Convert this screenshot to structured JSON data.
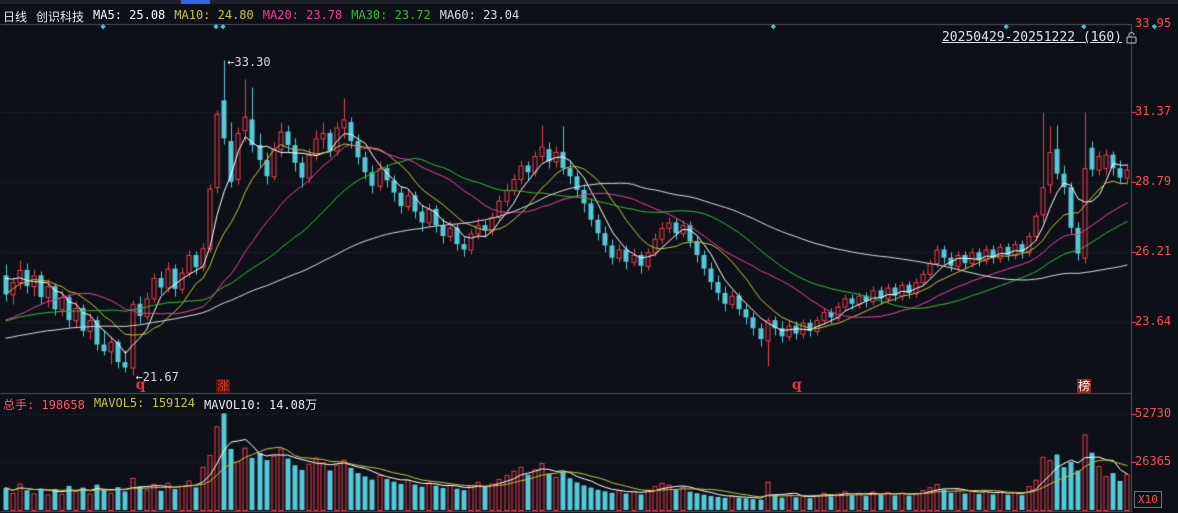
{
  "palette": {
    "background": "#0d1117",
    "up_red": "#f23a4c",
    "down_cyan": "#56c8d8",
    "axis_label_red": "#fb4d52",
    "grid_dotted": "#2b313b",
    "pane_border": "#4b5260",
    "ma5": "#ffffff",
    "ma10": "#c3c34a",
    "ma20": "#ec3f9e",
    "ma30": "#3cb53c",
    "ma60": "#d8dce4",
    "mavol5": "#ffffff",
    "mavol10": "#c3c34a",
    "header_text": "#e6e9ef",
    "annotation_text": "#d4d8de",
    "diamond_cyan": "#46c0cc",
    "scroll_thumb_blue": "#2e68e8",
    "badge_zhang_bg": "#5f1212",
    "badge_zhang_text": "#d93a3a",
    "badge_bang_bg": "#8d2727",
    "badge_bang_text": "#ffffff"
  },
  "header": {
    "period": "日线",
    "stock_name": "创识科技",
    "ma_items": [
      {
        "label": "MA5:",
        "value": "25.08",
        "color": "#ffffff"
      },
      {
        "label": "MA10:",
        "value": "24.80",
        "color": "#c3c34a"
      },
      {
        "label": "MA20:",
        "value": "23.78",
        "color": "#ec3f9e"
      },
      {
        "label": "MA30:",
        "value": "23.72",
        "color": "#3cb53c"
      },
      {
        "label": "MA60:",
        "value": "23.04",
        "color": "#d8dce4"
      }
    ]
  },
  "top_right": {
    "date_range": "20250429-20251222 (160)",
    "lock_icon": "lock"
  },
  "volume_header": {
    "items": [
      {
        "label": "总手:",
        "value": "198658",
        "color": "#ff5566"
      },
      {
        "label": "MAVOL5:",
        "value": "159124",
        "color": "#c3c34a"
      },
      {
        "label": "MAVOL10:",
        "value": "14.08万",
        "color": "#e8ecf2"
      }
    ]
  },
  "chart_data": {
    "type": "candlestick_with_volume",
    "title": "创识科技 日线",
    "date_range": "20250429-20251222",
    "bar_count": 160,
    "price_axis_labels": [
      "33.95",
      "31.37",
      "28.79",
      "26.21",
      "23.64"
    ],
    "price_axis_values": [
      33.95,
      31.37,
      28.79,
      26.21,
      23.64
    ],
    "volume_axis_labels": [
      "52730",
      "26365"
    ],
    "volume_axis_values": [
      52730,
      26365
    ],
    "volume_multiplier": "X10",
    "grid": "dotted-horizontal",
    "legend_position": "top-left",
    "annotations": {
      "high": {
        "text": "←33.30",
        "price": 33.3,
        "bar": 31
      },
      "low": {
        "text": "←21.67",
        "price": 21.67,
        "bar": 18
      }
    },
    "markers": [
      {
        "label": "q",
        "bar": 19,
        "style": "text"
      },
      {
        "label": "涨",
        "bar": 31,
        "style": "badge-dark"
      },
      {
        "label": "q",
        "bar": 112,
        "style": "text"
      },
      {
        "label": "榜",
        "bar": 153,
        "style": "badge-bright"
      }
    ],
    "event_diamond_bars": [
      14,
      30,
      31,
      109,
      142,
      153,
      163
    ],
    "ma_windows": [
      5,
      10,
      20,
      30,
      60
    ],
    "mavol_windows": [
      5,
      10
    ],
    "ma_seed_closes": [
      22.4,
      22.1,
      22.6,
      22.3,
      21.9,
      22.5,
      22.8,
      22.2,
      21.8,
      22.4,
      22.7,
      22.3,
      22.0,
      22.6,
      22.9,
      22.4,
      22.1,
      22.5,
      22.2,
      21.9,
      22.3,
      22.6,
      22.8,
      22.4,
      22.2,
      22.7,
      22.5,
      22.3,
      22.6,
      22.8,
      23.0,
      23.3,
      23.6,
      23.8,
      23.5,
      23.7,
      23.9,
      23.6,
      23.8,
      23.8,
      23.4,
      23.1,
      22.8,
      22.5,
      22.3,
      22.6,
      22.9,
      22.7,
      22.5,
      22.8,
      23.2,
      23.6,
      24.1,
      24.5,
      24.9,
      25.2,
      25.3,
      25.4,
      25.6
    ],
    "ohlc": [
      [
        25.35,
        25.75,
        24.4,
        24.65
      ],
      [
        24.65,
        25.3,
        24.3,
        25.1
      ],
      [
        25.1,
        25.9,
        24.85,
        25.55
      ],
      [
        25.55,
        25.8,
        24.7,
        24.95
      ],
      [
        24.95,
        25.6,
        24.6,
        25.35
      ],
      [
        25.35,
        25.5,
        24.3,
        24.55
      ],
      [
        24.55,
        25.2,
        24.2,
        24.95
      ],
      [
        24.95,
        25.05,
        23.9,
        24.1
      ],
      [
        24.1,
        24.8,
        23.85,
        24.55
      ],
      [
        24.55,
        24.65,
        23.45,
        23.7
      ],
      [
        23.7,
        24.4,
        23.4,
        24.15
      ],
      [
        24.15,
        24.3,
        23.1,
        23.3
      ],
      [
        23.3,
        23.95,
        23.0,
        23.7
      ],
      [
        23.7,
        23.85,
        22.6,
        22.8
      ],
      [
        22.8,
        23.35,
        22.4,
        22.55
      ],
      [
        22.55,
        23.1,
        22.1,
        22.9
      ],
      [
        22.9,
        23.0,
        21.95,
        22.15
      ],
      [
        22.15,
        22.6,
        21.8,
        21.95
      ],
      [
        21.95,
        24.45,
        21.67,
        24.3
      ],
      [
        24.3,
        24.6,
        23.6,
        23.85
      ],
      [
        23.85,
        24.75,
        23.7,
        24.5
      ],
      [
        24.5,
        25.45,
        24.35,
        25.25
      ],
      [
        25.25,
        25.5,
        24.65,
        24.9
      ],
      [
        24.9,
        25.85,
        24.75,
        25.6
      ],
      [
        25.6,
        25.75,
        24.6,
        24.85
      ],
      [
        24.85,
        25.65,
        24.7,
        25.45
      ],
      [
        25.45,
        26.3,
        25.3,
        26.1
      ],
      [
        26.1,
        26.25,
        25.4,
        25.65
      ],
      [
        25.65,
        26.55,
        25.5,
        26.35
      ],
      [
        26.35,
        28.7,
        26.2,
        28.55
      ],
      [
        28.6,
        31.45,
        28.4,
        31.3
      ],
      [
        31.8,
        33.3,
        30.2,
        30.4
      ],
      [
        30.3,
        31.0,
        28.6,
        28.8
      ],
      [
        28.9,
        30.8,
        28.7,
        30.6
      ],
      [
        30.7,
        32.6,
        30.3,
        31.2
      ],
      [
        31.1,
        32.3,
        29.9,
        30.15
      ],
      [
        30.15,
        30.6,
        29.3,
        29.6
      ],
      [
        29.6,
        29.9,
        28.7,
        29.0
      ],
      [
        29.0,
        30.25,
        28.85,
        30.0
      ],
      [
        30.0,
        31.0,
        29.7,
        30.65
      ],
      [
        30.65,
        30.9,
        29.9,
        30.15
      ],
      [
        30.15,
        30.4,
        29.2,
        29.5
      ],
      [
        29.5,
        29.75,
        28.6,
        28.95
      ],
      [
        28.95,
        30.05,
        28.8,
        29.8
      ],
      [
        29.8,
        30.7,
        29.6,
        30.4
      ],
      [
        30.4,
        31.0,
        30.05,
        30.6
      ],
      [
        30.6,
        30.75,
        29.7,
        29.95
      ],
      [
        29.95,
        31.0,
        29.8,
        30.8
      ],
      [
        30.8,
        31.9,
        30.4,
        31.1
      ],
      [
        31.0,
        31.2,
        30.05,
        30.3
      ],
      [
        30.3,
        30.55,
        29.45,
        29.7
      ],
      [
        29.7,
        29.95,
        28.9,
        29.15
      ],
      [
        29.15,
        29.4,
        28.4,
        28.65
      ],
      [
        28.65,
        29.55,
        28.5,
        29.3
      ],
      [
        29.3,
        29.45,
        28.6,
        28.85
      ],
      [
        28.85,
        29.05,
        28.1,
        28.4
      ],
      [
        28.4,
        28.65,
        27.65,
        27.9
      ],
      [
        27.9,
        28.55,
        27.75,
        28.3
      ],
      [
        28.3,
        28.45,
        27.45,
        27.7
      ],
      [
        27.7,
        27.95,
        27.0,
        27.3
      ],
      [
        27.3,
        28.0,
        27.15,
        27.8
      ],
      [
        27.8,
        27.95,
        26.95,
        27.2
      ],
      [
        27.2,
        27.45,
        26.55,
        26.8
      ],
      [
        26.8,
        27.35,
        26.6,
        27.1
      ],
      [
        27.1,
        27.25,
        26.3,
        26.5
      ],
      [
        26.5,
        26.75,
        26.05,
        26.3
      ],
      [
        26.3,
        27.05,
        26.15,
        26.9
      ],
      [
        26.9,
        27.45,
        26.7,
        27.2
      ],
      [
        27.2,
        27.4,
        26.75,
        27.0
      ],
      [
        27.0,
        27.7,
        26.85,
        27.5
      ],
      [
        27.5,
        28.3,
        27.35,
        28.1
      ],
      [
        28.1,
        28.75,
        27.9,
        28.5
      ],
      [
        28.5,
        29.1,
        28.3,
        28.9
      ],
      [
        28.9,
        29.6,
        28.7,
        29.4
      ],
      [
        29.4,
        29.55,
        28.85,
        29.15
      ],
      [
        29.15,
        29.95,
        29.0,
        29.75
      ],
      [
        29.75,
        30.9,
        29.55,
        30.1
      ],
      [
        30.0,
        30.25,
        29.3,
        29.55
      ],
      [
        29.55,
        30.1,
        29.35,
        29.9
      ],
      [
        29.9,
        30.85,
        29.1,
        29.3
      ],
      [
        29.3,
        29.6,
        28.7,
        29.0
      ],
      [
        29.0,
        29.2,
        28.25,
        28.5
      ],
      [
        28.5,
        28.7,
        27.7,
        28.0
      ],
      [
        28.0,
        28.2,
        27.15,
        27.4
      ],
      [
        27.4,
        27.6,
        26.65,
        26.9
      ],
      [
        26.9,
        27.15,
        26.2,
        26.45
      ],
      [
        26.45,
        26.7,
        25.75,
        26.0
      ],
      [
        26.0,
        26.5,
        25.85,
        26.3
      ],
      [
        26.3,
        26.45,
        25.6,
        25.85
      ],
      [
        25.85,
        26.35,
        25.7,
        26.1
      ],
      [
        26.1,
        26.25,
        25.45,
        25.7
      ],
      [
        25.7,
        26.35,
        25.55,
        26.2
      ],
      [
        26.2,
        26.9,
        26.05,
        26.7
      ],
      [
        26.7,
        27.3,
        26.55,
        27.1
      ],
      [
        27.1,
        27.5,
        26.9,
        27.3
      ],
      [
        27.3,
        27.45,
        26.7,
        26.9
      ],
      [
        26.9,
        27.4,
        26.75,
        27.2
      ],
      [
        27.2,
        27.35,
        26.4,
        26.6
      ],
      [
        26.6,
        26.8,
        25.85,
        26.1
      ],
      [
        26.1,
        26.3,
        25.35,
        25.6
      ],
      [
        25.6,
        25.85,
        24.85,
        25.1
      ],
      [
        25.1,
        25.35,
        24.45,
        24.7
      ],
      [
        24.7,
        24.95,
        24.05,
        24.3
      ],
      [
        24.3,
        24.8,
        24.15,
        24.6
      ],
      [
        24.6,
        24.75,
        23.9,
        24.1
      ],
      [
        24.1,
        24.3,
        23.55,
        23.8
      ],
      [
        23.8,
        24.0,
        23.15,
        23.4
      ],
      [
        23.4,
        23.6,
        22.75,
        23.0
      ],
      [
        22.95,
        23.8,
        22.02,
        23.7
      ],
      [
        23.7,
        23.85,
        23.15,
        23.4
      ],
      [
        23.4,
        23.65,
        22.9,
        23.1
      ],
      [
        23.1,
        23.7,
        22.95,
        23.5
      ],
      [
        23.5,
        23.65,
        23.0,
        23.2
      ],
      [
        23.2,
        23.75,
        23.05,
        23.6
      ],
      [
        23.6,
        23.75,
        23.1,
        23.3
      ],
      [
        23.3,
        23.85,
        23.15,
        23.7
      ],
      [
        23.7,
        24.15,
        23.55,
        24.0
      ],
      [
        24.0,
        24.15,
        23.6,
        23.8
      ],
      [
        23.8,
        24.35,
        23.65,
        24.2
      ],
      [
        24.2,
        24.65,
        24.05,
        24.5
      ],
      [
        24.5,
        24.65,
        24.1,
        24.3
      ],
      [
        24.3,
        24.75,
        24.15,
        24.6
      ],
      [
        24.6,
        24.75,
        24.2,
        24.4
      ],
      [
        24.4,
        24.95,
        24.25,
        24.8
      ],
      [
        24.8,
        24.95,
        24.3,
        24.5
      ],
      [
        24.5,
        25.05,
        24.35,
        24.9
      ],
      [
        24.9,
        25.05,
        24.4,
        24.6
      ],
      [
        24.6,
        25.15,
        24.45,
        25.0
      ],
      [
        25.0,
        25.15,
        24.5,
        24.7
      ],
      [
        24.7,
        25.25,
        24.55,
        25.1
      ],
      [
        25.1,
        25.55,
        24.95,
        25.4
      ],
      [
        25.4,
        25.95,
        25.25,
        25.8
      ],
      [
        25.8,
        26.45,
        25.65,
        26.3
      ],
      [
        26.3,
        26.45,
        25.8,
        26.0
      ],
      [
        26.0,
        26.2,
        25.5,
        25.7
      ],
      [
        25.7,
        26.25,
        25.55,
        26.1
      ],
      [
        26.1,
        26.25,
        25.6,
        25.8
      ],
      [
        25.8,
        26.35,
        25.65,
        26.2
      ],
      [
        26.2,
        26.35,
        25.7,
        25.9
      ],
      [
        25.9,
        26.45,
        25.75,
        26.3
      ],
      [
        26.3,
        26.45,
        25.8,
        26.0
      ],
      [
        26.0,
        26.55,
        25.85,
        26.4
      ],
      [
        26.4,
        26.55,
        25.9,
        26.1
      ],
      [
        26.1,
        26.65,
        25.95,
        26.5
      ],
      [
        26.5,
        26.65,
        26.0,
        26.2
      ],
      [
        26.2,
        26.95,
        26.05,
        26.8
      ],
      [
        26.8,
        27.7,
        26.6,
        27.55
      ],
      [
        27.6,
        31.37,
        27.3,
        28.6
      ],
      [
        28.7,
        30.85,
        28.4,
        29.9
      ],
      [
        30.0,
        30.9,
        28.9,
        29.1
      ],
      [
        29.1,
        29.4,
        28.35,
        28.6
      ],
      [
        28.6,
        28.8,
        26.9,
        27.1
      ],
      [
        27.1,
        27.3,
        25.9,
        26.15
      ],
      [
        26.0,
        31.37,
        25.8,
        29.3
      ],
      [
        30.05,
        30.3,
        29.0,
        29.25
      ],
      [
        29.25,
        29.95,
        29.05,
        29.75
      ],
      [
        29.3,
        30.0,
        29.1,
        29.8
      ],
      [
        29.8,
        29.95,
        29.05,
        29.3
      ],
      [
        29.3,
        29.6,
        28.75,
        28.95
      ],
      [
        28.95,
        29.5,
        28.7,
        29.25
      ]
    ],
    "volume": [
      12500,
      9800,
      14800,
      11200,
      9500,
      12100,
      8900,
      11800,
      9200,
      13500,
      10800,
      12600,
      9400,
      14200,
      11500,
      9800,
      12800,
      10500,
      17800,
      13200,
      11600,
      14500,
      10900,
      15200,
      11800,
      13600,
      16400,
      12700,
      23800,
      30200,
      45600,
      52500,
      33400,
      26800,
      34100,
      28600,
      31200,
      27400,
      29800,
      33600,
      28200,
      24600,
      22100,
      25400,
      28800,
      26200,
      21800,
      24900,
      27600,
      23200,
      20400,
      18600,
      16900,
      19400,
      17200,
      15800,
      14600,
      16800,
      14200,
      13100,
      15400,
      13600,
      12400,
      14100,
      12000,
      11200,
      13800,
      15600,
      12900,
      14800,
      17200,
      19400,
      21600,
      23800,
      19600,
      22400,
      25800,
      20200,
      18400,
      21200,
      17600,
      15400,
      13800,
      12600,
      11400,
      10600,
      9800,
      11200,
      9400,
      10800,
      8900,
      11600,
      13400,
      15200,
      14100,
      11800,
      12900,
      10400,
      9600,
      8800,
      8100,
      7600,
      7100,
      8400,
      7200,
      6800,
      6400,
      6100,
      15800,
      8600,
      7200,
      8900,
      7400,
      8200,
      6900,
      8600,
      9800,
      7800,
      9400,
      10600,
      8400,
      9800,
      8100,
      10400,
      8600,
      10100,
      8300,
      9900,
      8200,
      9600,
      11200,
      12800,
      14600,
      11400,
      9800,
      11600,
      9400,
      11100,
      9200,
      10800,
      8900,
      10400,
      8700,
      10200,
      8500,
      13400,
      16800,
      29200,
      27400,
      30400,
      23600,
      26400,
      21800,
      41200,
      31400,
      24200,
      18800,
      20400,
      16200,
      19866
    ]
  }
}
